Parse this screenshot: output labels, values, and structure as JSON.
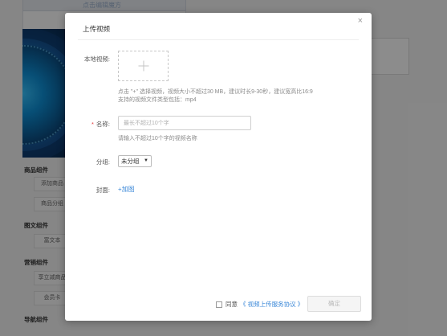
{
  "background": {
    "top_tab_text": "点击编辑魔方",
    "sidebar": [
      {
        "section": "商品组件",
        "buttons": [
          "添加商品",
          "商品分组"
        ]
      },
      {
        "section": "图文组件",
        "buttons": [
          "富文本"
        ]
      },
      {
        "section": "营销组件",
        "buttons": [
          "享立减商品",
          "会员卡"
        ]
      },
      {
        "section": "导航组件",
        "buttons": []
      }
    ]
  },
  "modal": {
    "close_label": "×",
    "title": "上传视频",
    "local_video": {
      "label": "本地视频:",
      "hint_line1": "点击 \"+\" 选择视频，视频大小不超过30 MB，建议时长9-30秒，建议宽高比16:9",
      "hint_line2": "支持的视频文件类型包括：mp4"
    },
    "name": {
      "required_mark": "*",
      "label": "名称:",
      "placeholder": "最长不超过10个字",
      "value": "",
      "hint": "请输入不超过10个字的视频名称"
    },
    "group": {
      "label": "分组:",
      "selected": "未分组",
      "arrow": "▼"
    },
    "cover": {
      "label": "封面:",
      "add_label": "+加图"
    },
    "footer": {
      "agree_label": "同意",
      "agreement_link": "《 视频上传服务协议 》",
      "confirm_label": "确定"
    }
  }
}
